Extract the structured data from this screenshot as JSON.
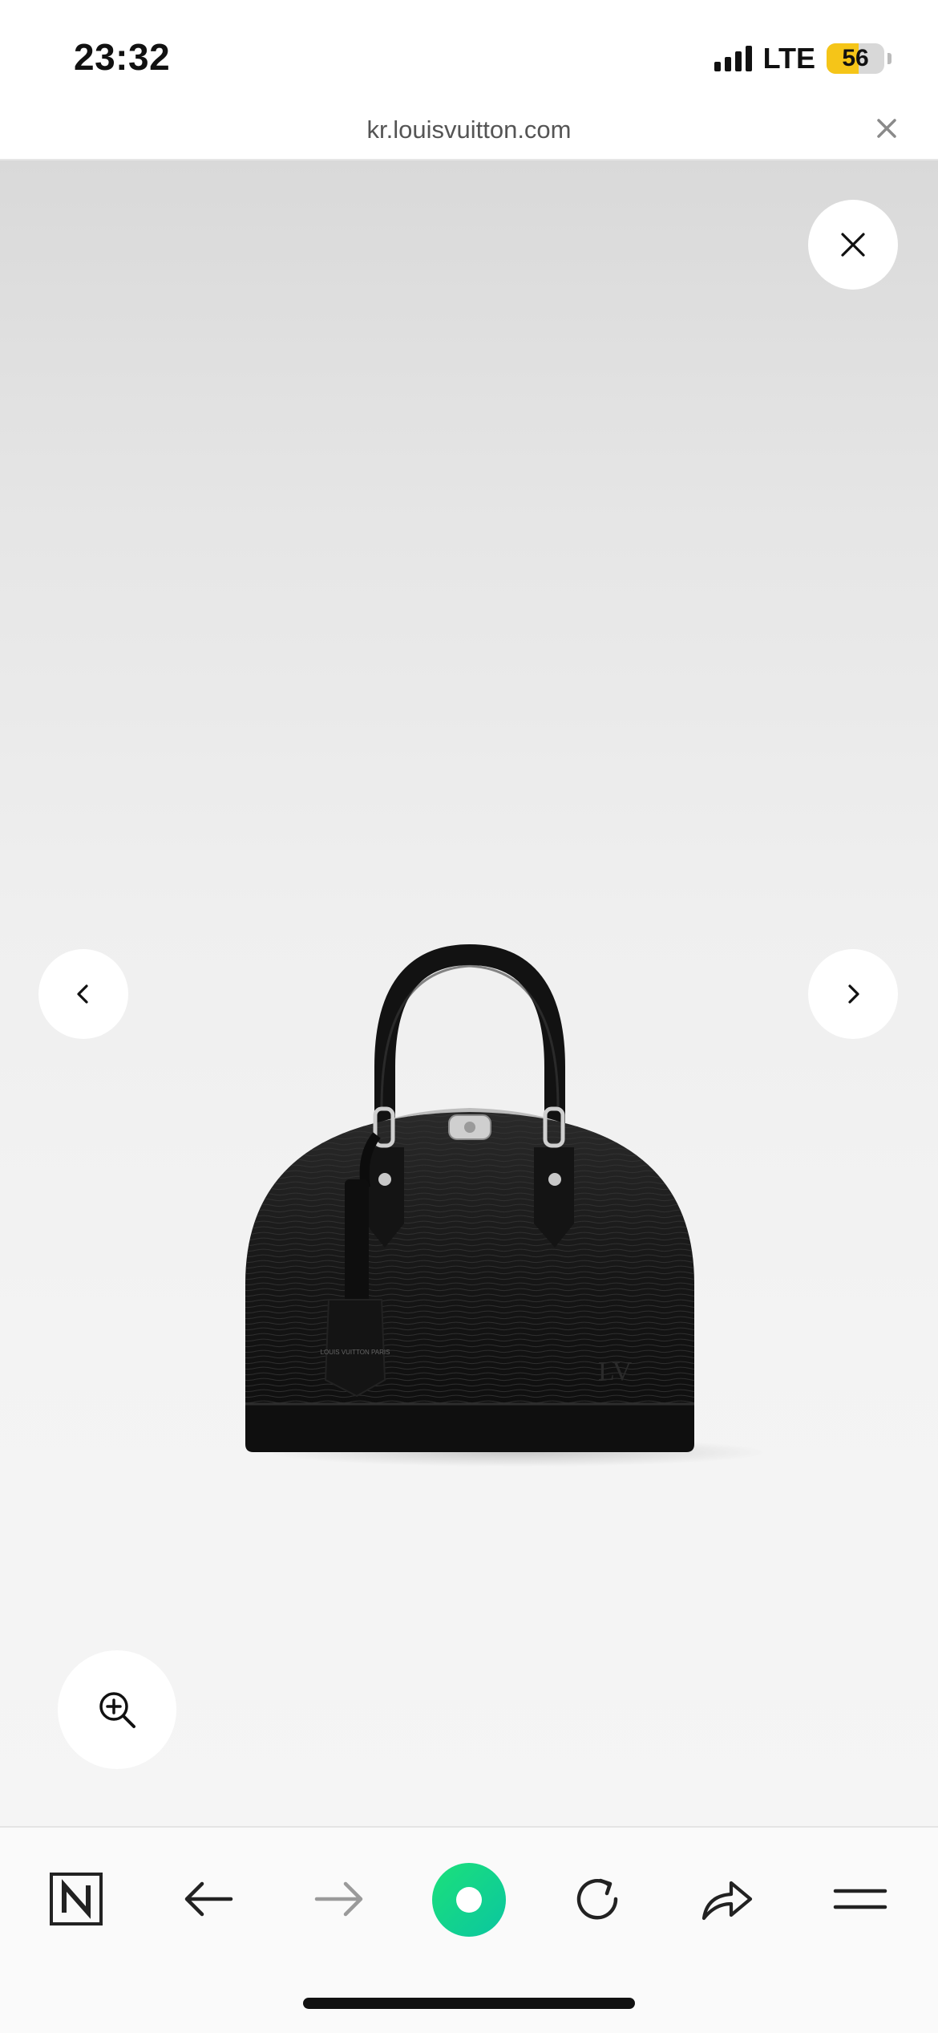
{
  "status_bar": {
    "time": "23:32",
    "carrier": "LTE",
    "battery_level": "56",
    "battery_fraction": 0.56,
    "signal_bars": 4,
    "icons": [
      "cellular-signal-icon",
      "battery-icon"
    ]
  },
  "browser": {
    "url": "kr.louisvuitton.com",
    "close_icon": "close-icon"
  },
  "viewer": {
    "product_image": "black-epi-leather-dome-handbag",
    "logo_text": "LV",
    "tag_text": "LOUIS VUITTON PARIS",
    "controls": {
      "close": "close-icon",
      "previous": "chevron-left-icon",
      "next": "chevron-right-icon",
      "zoom": "zoom-in-icon"
    },
    "colors": {
      "background_top": "#d9d9d9",
      "background_bottom": "#f5f5f5",
      "bag": "#161616"
    }
  },
  "toolbar": {
    "buttons": [
      "naver-home-icon",
      "back-arrow-icon",
      "forward-arrow-icon",
      "green-dot-icon",
      "reload-icon",
      "share-icon",
      "menu-icon"
    ],
    "accent_color": "#12d36d"
  }
}
